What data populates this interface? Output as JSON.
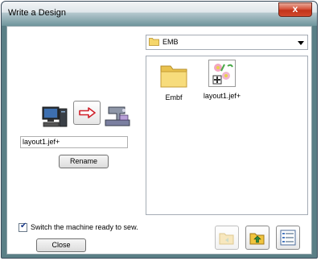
{
  "window": {
    "title": "Write a Design",
    "close_glyph": "x"
  },
  "folder": {
    "selected": "EMB"
  },
  "files": [
    {
      "name": "Embf",
      "icon": "folder-icon"
    },
    {
      "name": "layout1.jef+",
      "icon": "embroidery-design-icon"
    }
  ],
  "transfer": {
    "source_icon": "computer-icon",
    "direction_icon": "red-arrow-right-icon",
    "target_icon": "sewing-machine-icon"
  },
  "filename": {
    "value": "layout1.jef+"
  },
  "buttons": {
    "rename": "Rename",
    "close": "Close"
  },
  "switch_machine": {
    "label": "Switch the machine ready to sew.",
    "checked": true
  },
  "toolbar": {
    "icons": [
      "folder-back-icon",
      "folder-up-icon",
      "view-details-icon"
    ]
  },
  "colors": {
    "arrow_red": "#d0202a",
    "folder_yellow": "#f5d66a",
    "titlebar": "#6f959c"
  }
}
